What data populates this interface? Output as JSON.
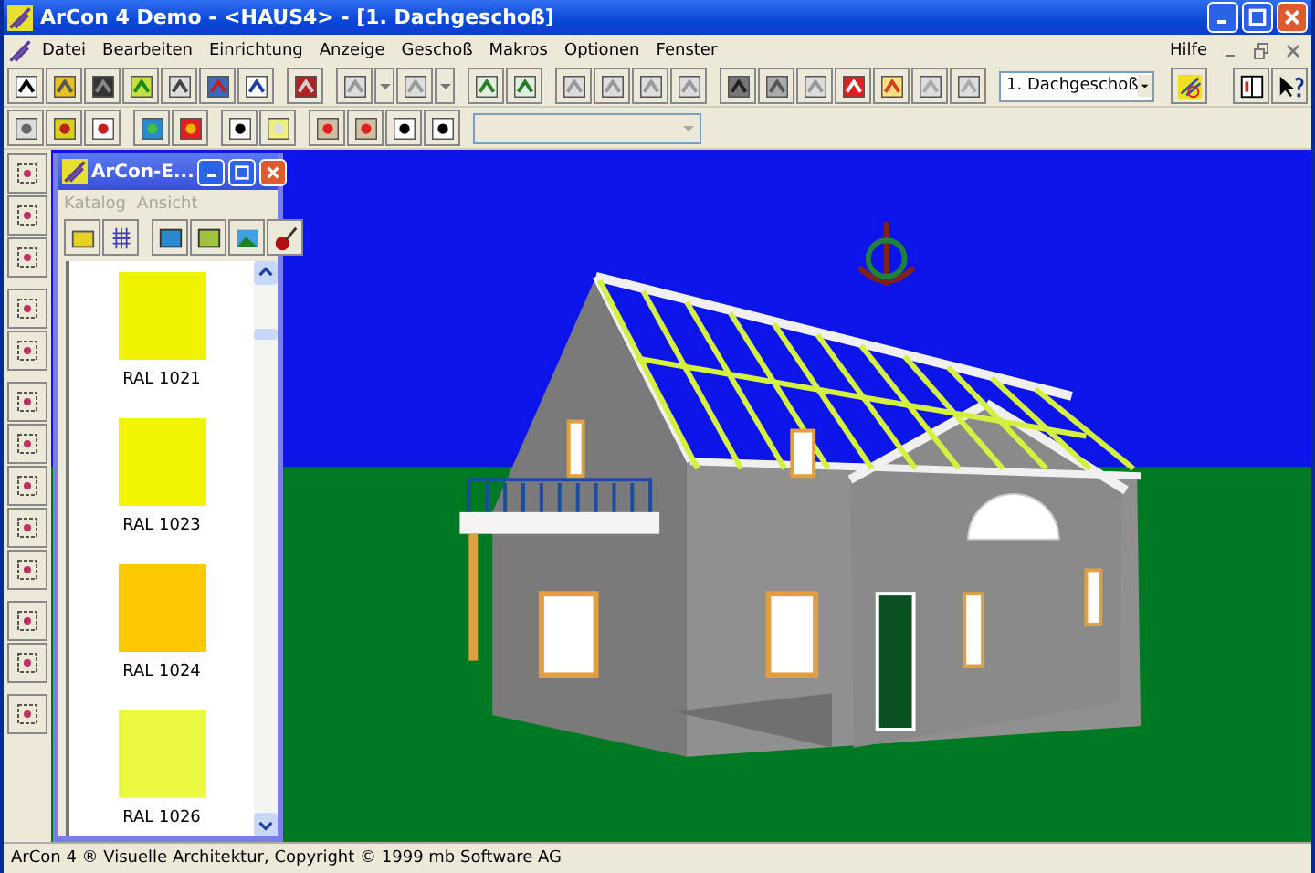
{
  "window": {
    "title": "ArCon  4 Demo - <HAUS4> - [1. Dachgeschoß]"
  },
  "menu": [
    {
      "label": "Datei"
    },
    {
      "label": "Bearbeiten"
    },
    {
      "label": "Einrichtung"
    },
    {
      "label": "Anzeige"
    },
    {
      "label": "Geschoß"
    },
    {
      "label": "Makros"
    },
    {
      "label": "Optionen"
    },
    {
      "label": "Fenster"
    }
  ],
  "help_menu": {
    "label": "Hilfe"
  },
  "floor_select": {
    "value": "1. Dachgeschoß"
  },
  "catalog": {
    "title": "ArCon-E...",
    "menu": [
      {
        "label": "Katalog",
        "disabled": true
      },
      {
        "label": "Ansicht",
        "disabled": true
      }
    ],
    "items": [
      {
        "label": "RAL 1021",
        "color": "#eef400"
      },
      {
        "label": "RAL 1023",
        "color": "#f2f500"
      },
      {
        "label": "RAL 1024",
        "color": "#fdc800"
      },
      {
        "label": "RAL 1026",
        "color": "#ebfa40"
      }
    ]
  },
  "status_bar": {
    "text": "ArCon 4 ® Visuelle Architektur, Copyright © 1999 mb Software AG"
  }
}
